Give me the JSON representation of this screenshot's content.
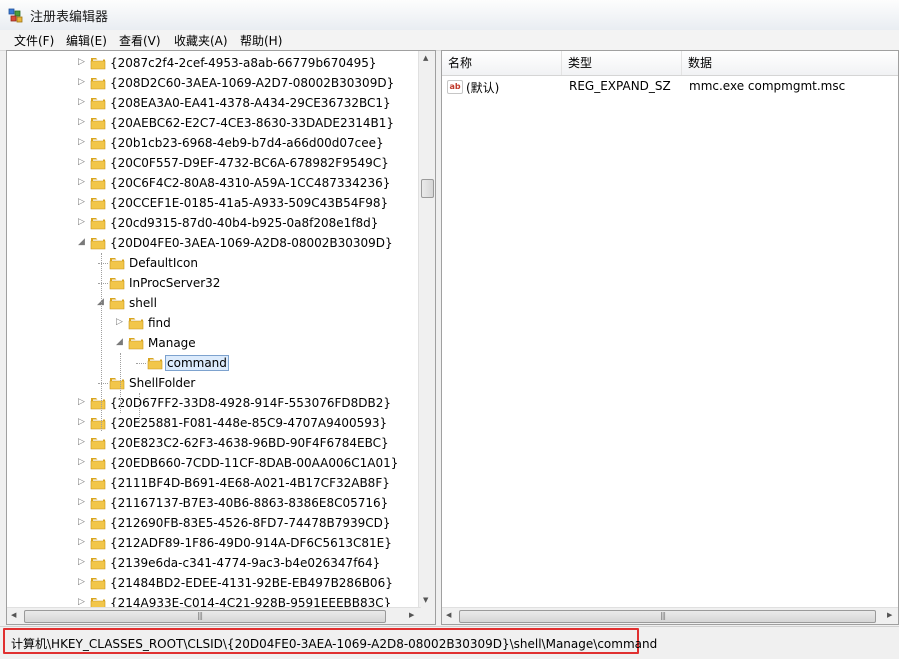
{
  "window": {
    "title": "注册表编辑器"
  },
  "menu": [
    "文件(F)",
    "编辑(E)",
    "查看(V)",
    "收藏夹(A)",
    "帮助(H)"
  ],
  "tree": [
    {
      "label": "{2087c2f4-2cef-4953-a8ab-66779b670495}",
      "depth": 0,
      "toggle": "collapsed"
    },
    {
      "label": "{208D2C60-3AEA-1069-A2D7-08002B30309D}",
      "depth": 0,
      "toggle": "collapsed"
    },
    {
      "label": "{208EA3A0-EA41-4378-A434-29CE36732BC1}",
      "depth": 0,
      "toggle": "collapsed"
    },
    {
      "label": "{20AEBC62-E2C7-4CE3-8630-33DADE2314B1}",
      "depth": 0,
      "toggle": "collapsed"
    },
    {
      "label": "{20b1cb23-6968-4eb9-b7d4-a66d00d07cee}",
      "depth": 0,
      "toggle": "collapsed"
    },
    {
      "label": "{20C0F557-D9EF-4732-BC6A-678982F9549C}",
      "depth": 0,
      "toggle": "collapsed"
    },
    {
      "label": "{20C6F4C2-80A8-4310-A59A-1CC487334236}",
      "depth": 0,
      "toggle": "collapsed"
    },
    {
      "label": "{20CCEF1E-0185-41a5-A933-509C43B54F98}",
      "depth": 0,
      "toggle": "collapsed"
    },
    {
      "label": "{20cd9315-87d0-40b4-b925-0a8f208e1f8d}",
      "depth": 0,
      "toggle": "collapsed"
    },
    {
      "label": "{20D04FE0-3AEA-1069-A2D8-08002B30309D}",
      "depth": 0,
      "toggle": "expanded"
    },
    {
      "label": "DefaultIcon",
      "depth": 1,
      "toggle": "none"
    },
    {
      "label": "InProcServer32",
      "depth": 1,
      "toggle": "none"
    },
    {
      "label": "shell",
      "depth": 1,
      "toggle": "expanded"
    },
    {
      "label": "find",
      "depth": 2,
      "toggle": "collapsed"
    },
    {
      "label": "Manage",
      "depth": 2,
      "toggle": "expanded"
    },
    {
      "label": "command",
      "depth": 3,
      "toggle": "none",
      "selected": true
    },
    {
      "label": "ShellFolder",
      "depth": 1,
      "toggle": "none"
    },
    {
      "label": "{20D67FF2-33D8-4928-914F-553076FD8DB2}",
      "depth": 0,
      "toggle": "collapsed"
    },
    {
      "label": "{20E25881-F081-448e-85C9-4707A9400593}",
      "depth": 0,
      "toggle": "collapsed"
    },
    {
      "label": "{20E823C2-62F3-4638-96BD-90F4F6784EBC}",
      "depth": 0,
      "toggle": "collapsed"
    },
    {
      "label": "{20EDB660-7CDD-11CF-8DAB-00AA006C1A01}",
      "depth": 0,
      "toggle": "collapsed"
    },
    {
      "label": "{2111BF4D-B691-4E68-A021-4B17CF32AB8F}",
      "depth": 0,
      "toggle": "collapsed"
    },
    {
      "label": "{21167137-B7E3-40B6-8863-8386E8C05716}",
      "depth": 0,
      "toggle": "collapsed"
    },
    {
      "label": "{212690FB-83E5-4526-8FD7-74478B7939CD}",
      "depth": 0,
      "toggle": "collapsed"
    },
    {
      "label": "{212ADF89-1F86-49D0-914A-DF6C5613C81E}",
      "depth": 0,
      "toggle": "collapsed"
    },
    {
      "label": "{2139e6da-c341-4774-9ac3-b4e026347f64}",
      "depth": 0,
      "toggle": "collapsed"
    },
    {
      "label": "{21484BD2-EDEE-4131-92BE-EB497B286B06}",
      "depth": 0,
      "toggle": "collapsed"
    },
    {
      "label": "{214A933E-C014-4C21-928B-9591EEEBB83C}",
      "depth": 0,
      "toggle": "collapsed"
    }
  ],
  "list": {
    "columns": [
      "名称",
      "类型",
      "数据"
    ],
    "rows": [
      {
        "name": "(默认)",
        "type": "REG_EXPAND_SZ",
        "data": "mmc.exe compmgmt.msc",
        "icon": "ab"
      }
    ]
  },
  "status": {
    "path": "计算机\\HKEY_CLASSES_ROOT\\CLSID\\{20D04FE0-3AEA-1069-A2D8-08002B30309D}\\shell\\Manage\\command"
  },
  "colors": {
    "folder": "#f2c64a",
    "highlight_border": "#e03030",
    "selection": "#dcebfc"
  },
  "icons": {
    "app": "registry-editor-icon",
    "folder": "folder-icon",
    "string_value": "string-value-icon"
  },
  "scroll_glyphs": {
    "up": "▲",
    "down": "▼",
    "left": "◀",
    "right": "▶",
    "grip": "|||"
  }
}
